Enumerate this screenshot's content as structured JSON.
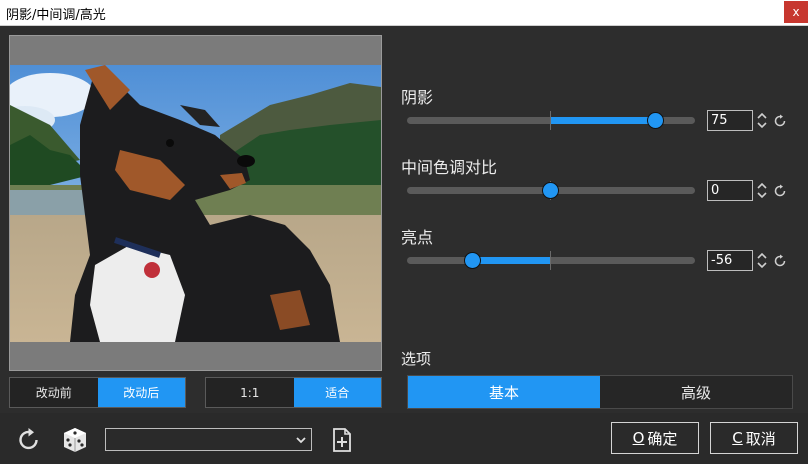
{
  "window": {
    "title": "阴影/中间调/高光",
    "close_glyph": "x"
  },
  "preview": {
    "before_label": "改动前",
    "after_label": "改动后",
    "zoom_1to1_label": "1:1",
    "fit_label": "适合"
  },
  "adjustments": {
    "shadows": {
      "label": "阴影",
      "value": "75",
      "level": 75
    },
    "midtone_contrast": {
      "label": "中间色调对比",
      "value": "0",
      "level": 0
    },
    "highlights": {
      "label": "亮点",
      "value": "-56",
      "level": -56
    }
  },
  "options": {
    "label": "选项",
    "tabs": [
      "基本",
      "高级"
    ],
    "active_tab": "基本"
  },
  "footer": {
    "preset_value": "",
    "ok_key": "O",
    "ok_label": "确定",
    "cancel_key": "C",
    "cancel_label": "取消"
  },
  "colors": {
    "accent": "#2196f3",
    "background": "#2d2d2d",
    "close": "#c7372f"
  },
  "icons": [
    "reset-icon",
    "random-dice-icon",
    "new-preset-icon",
    "chevron-down-icon",
    "spin-arrows-icon",
    "close-icon"
  ]
}
